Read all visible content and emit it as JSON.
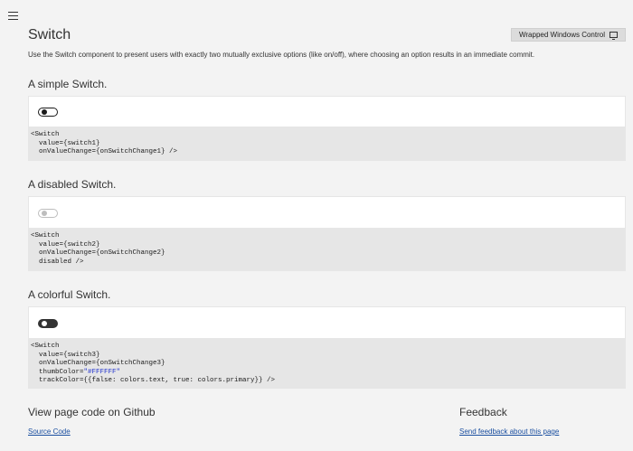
{
  "page": {
    "title": "Switch",
    "description": "Use the Switch component to present users with exactly two mutually exclusive options (like on/off), where choosing an option results in an immediate commit.",
    "wrapped_label": "Wrapped Windows Control",
    "wrapped_icon": "monitor-icon",
    "menu_icon": "hamburger-menu-icon"
  },
  "sections": [
    {
      "heading": "A simple Switch.",
      "switch_state": {
        "value": false,
        "disabled": false
      },
      "code": [
        "<Switch",
        "  value={switch1}",
        "  onValueChange={onSwitchChange1} />"
      ]
    },
    {
      "heading": "A disabled Switch.",
      "switch_state": {
        "value": false,
        "disabled": true
      },
      "code": [
        "<Switch",
        "  value={switch2}",
        "  onValueChange={onSwitchChange2}",
        "  disabled />"
      ]
    },
    {
      "heading": "A colorful Switch.",
      "switch_state": {
        "value": false,
        "disabled": false
      },
      "code": [
        "<Switch",
        "  value={switch3}",
        "  onValueChange={onSwitchChange3}",
        "  thumbColor=",
        "\"#FFFFFF\"",
        "  trackColor={{false: colors.text, true: colors.primary}} />"
      ]
    }
  ],
  "footer": {
    "github_heading": "View page code on Github",
    "github_link": "Source Code",
    "feedback_heading": "Feedback",
    "feedback_link": "Send feedback about this page"
  },
  "colors": {
    "background": "#f3f3f3",
    "card": "#ffffff",
    "code_background": "#e6e6e6",
    "link": "#1a4fa0",
    "string_literal": "#2233cc",
    "switch3_track": "#333333",
    "switch3_thumb": "#ffffff"
  }
}
